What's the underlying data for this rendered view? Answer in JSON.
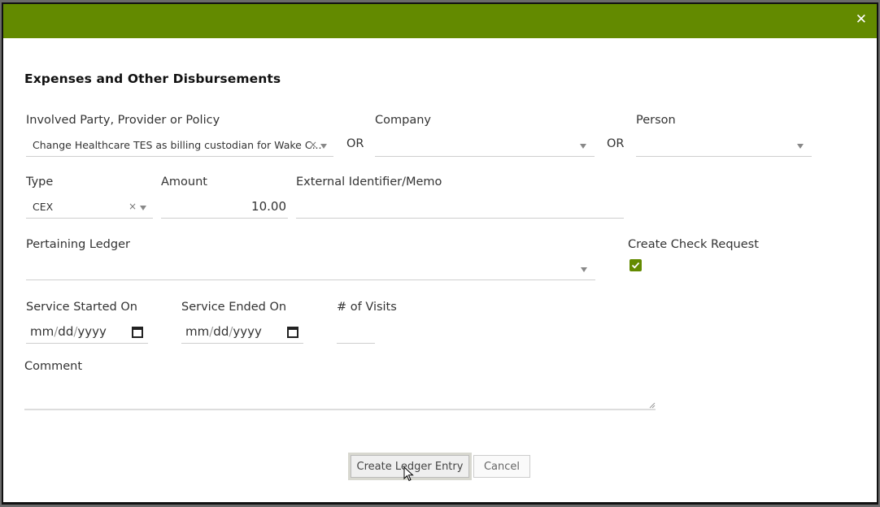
{
  "dialog": {
    "header_color": "#638a00",
    "close_icon": "close-icon",
    "title": "Expenses and Other Disbursements"
  },
  "fields": {
    "involved_party": {
      "label": "Involved Party, Provider or Policy",
      "value": "Change Healthcare TES as billing custodian for Wake C...",
      "clear": "×"
    },
    "or_1": "OR",
    "company": {
      "label": "Company",
      "value": ""
    },
    "or_2": "OR",
    "person": {
      "label": "Person",
      "value": ""
    },
    "type": {
      "label": "Type",
      "value": "CEX",
      "clear": "×"
    },
    "amount": {
      "label": "Amount",
      "value": "10.00"
    },
    "external_identifier": {
      "label": "External Identifier/Memo",
      "value": ""
    },
    "pertaining_ledger": {
      "label": "Pertaining Ledger",
      "value": ""
    },
    "create_check_request": {
      "label": "Create Check Request",
      "checked": true
    },
    "service_started_on": {
      "label": "Service Started On",
      "mm": "mm",
      "dd": "dd",
      "yyyy": "yyyy",
      "sep": "/"
    },
    "service_ended_on": {
      "label": "Service Ended On",
      "mm": "mm",
      "dd": "dd",
      "yyyy": "yyyy",
      "sep": "/"
    },
    "num_visits": {
      "label": "# of Visits",
      "value": ""
    },
    "comment": {
      "label": "Comment",
      "value": ""
    }
  },
  "buttons": {
    "create_ledger_entry": "Create Ledger Entry",
    "cancel": "Cancel"
  }
}
